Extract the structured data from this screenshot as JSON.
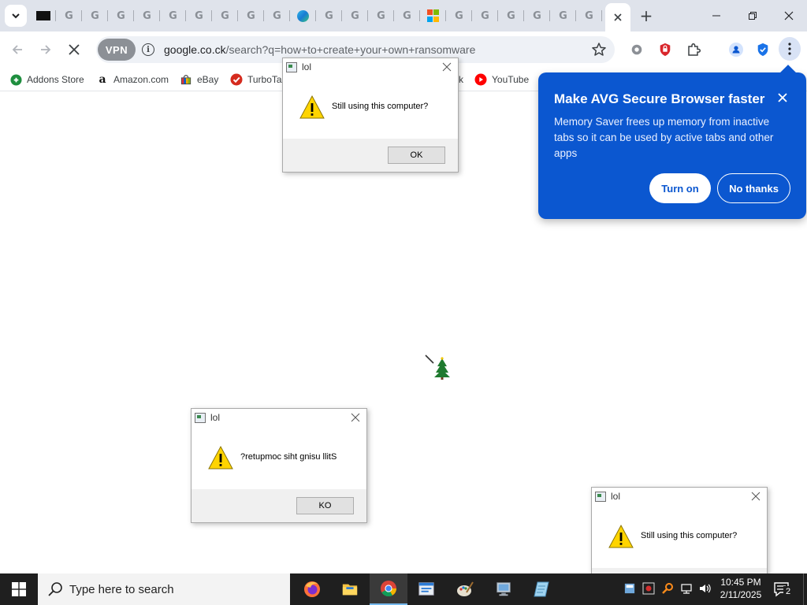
{
  "browser": {
    "url_host": "google.co.ck",
    "url_path": "/search?q=how+to+create+your+own+ransomware",
    "vpn_label": "VPN",
    "tabs": [
      {
        "icon": "news-icon"
      },
      {
        "icon": "google-icon",
        "letter": "G"
      },
      {
        "icon": "google-icon",
        "letter": "G"
      },
      {
        "icon": "google-icon",
        "letter": "G"
      },
      {
        "icon": "google-icon",
        "letter": "G"
      },
      {
        "icon": "google-icon",
        "letter": "G"
      },
      {
        "icon": "google-icon",
        "letter": "G"
      },
      {
        "icon": "google-icon",
        "letter": "G"
      },
      {
        "icon": "google-icon",
        "letter": "G"
      },
      {
        "icon": "google-icon",
        "letter": "G"
      },
      {
        "icon": "edge-icon"
      },
      {
        "icon": "google-icon",
        "letter": "G"
      },
      {
        "icon": "google-icon",
        "letter": "G"
      },
      {
        "icon": "google-icon",
        "letter": "G"
      },
      {
        "icon": "google-icon",
        "letter": "G"
      },
      {
        "icon": "microsoft-icon"
      },
      {
        "icon": "google-icon",
        "letter": "G"
      },
      {
        "icon": "google-icon",
        "letter": "G"
      },
      {
        "icon": "google-icon",
        "letter": "G"
      },
      {
        "icon": "google-icon",
        "letter": "G"
      },
      {
        "icon": "google-icon",
        "letter": "G"
      },
      {
        "icon": "google-icon",
        "letter": "G"
      }
    ]
  },
  "bookmarks": [
    {
      "label": "Addons Store",
      "icon": "addons-icon"
    },
    {
      "label": "Amazon.com",
      "icon": "amazon-icon"
    },
    {
      "label": "eBay",
      "icon": "ebay-icon"
    },
    {
      "label": "TurboTa",
      "icon": "turbotax-icon"
    },
    {
      "label": "k",
      "icon": ""
    },
    {
      "label": "YouTube",
      "icon": "youtube-icon"
    }
  ],
  "avg_popup": {
    "title": "Make AVG Secure Browser faster",
    "body": "Memory Saver frees up memory from inactive tabs so it can be used by active tabs and other apps",
    "turn_on": "Turn on",
    "no_thanks": "No thanks",
    "color": "#0b57d0"
  },
  "dialogs": [
    {
      "title": "lol",
      "message": "Still using this computer?",
      "button": "OK"
    },
    {
      "title": "lol",
      "message": "?retupmoc siht gnisu llitS",
      "button": "KO"
    },
    {
      "title": "lol",
      "message": "Still using this computer?",
      "button": ""
    }
  ],
  "taskbar": {
    "search_placeholder": "Type here to search",
    "time": "10:45 PM",
    "date": "2/11/2025",
    "notification_count": "2",
    "apps": [
      "firefox-icon",
      "file-explorer-icon",
      "chrome-icon",
      "window-app-icon",
      "paint-icon",
      "monitor-app-icon",
      "notepad-icon"
    ]
  }
}
